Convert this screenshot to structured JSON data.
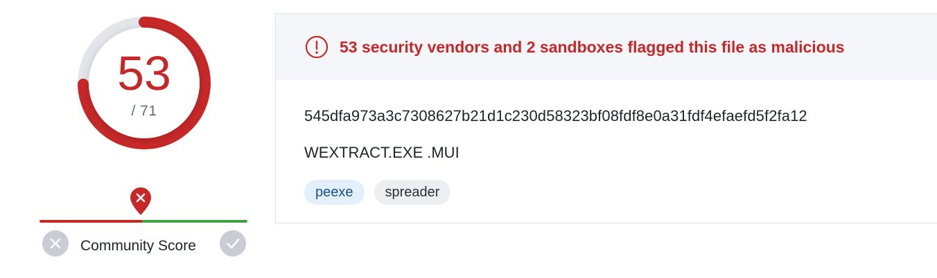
{
  "detection": {
    "malicious": 53,
    "total_label": "/ 71",
    "total": 71,
    "ring_color": "#c62828",
    "track_color": "#e2e5ea"
  },
  "community": {
    "label": "Community Score",
    "marker_icon": "location-pin-x-icon",
    "bad_color": "#c62828",
    "good_color": "#43a047",
    "down_vote_icon": "close-icon",
    "up_vote_icon": "checkmark-icon"
  },
  "card": {
    "alert_icon": "exclamation-circle-icon",
    "alert_text": "53 security vendors and 2 sandboxes flagged this file as malicious",
    "hash": "545dfa973a3c7308627b21d1c230d58323bf08fdf8e0a31fdf4efaefd5f2fa12",
    "filename": "WEXTRACT.EXE .MUI",
    "tags": [
      {
        "label": "peexe"
      },
      {
        "label": "spreader"
      }
    ]
  }
}
